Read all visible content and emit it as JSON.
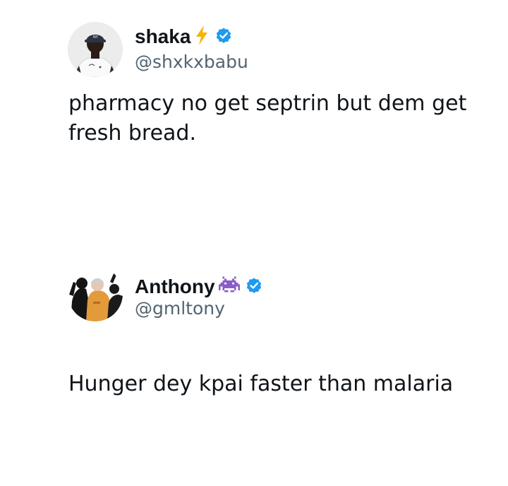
{
  "tweets": [
    {
      "display_name": "shaka",
      "name_emoji": "lightning-icon",
      "handle": "@shxkxbabu",
      "text": "pharmacy no get septrin but dem get fresh bread.",
      "verified": true,
      "verified_color": "#1d9bf0"
    },
    {
      "display_name": "Anthony",
      "name_emoji": "alien-monster-icon",
      "handle": "@gmltony",
      "text": "Hunger dey kpai faster than malaria",
      "verified": true,
      "verified_color": "#1d9bf0"
    }
  ],
  "colors": {
    "text": "#0f1419",
    "handle": "#536471",
    "lightning": "#f5b400",
    "alien": "#8a5cc7"
  }
}
